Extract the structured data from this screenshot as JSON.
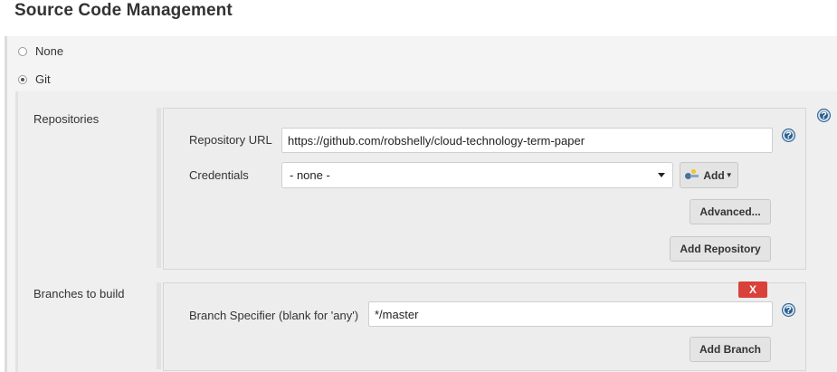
{
  "section": {
    "title": "Source Code Management"
  },
  "scm_options": [
    {
      "label": "None",
      "selected": false
    },
    {
      "label": "Git",
      "selected": true
    }
  ],
  "repositories": {
    "label": "Repositories",
    "url_label": "Repository URL",
    "url_value": "https://github.com/robshelly/cloud-technology-term-paper",
    "credentials_label": "Credentials",
    "credentials_value": "- none -",
    "add_credentials_label": "Add",
    "advanced_label": "Advanced...",
    "add_repository_label": "Add Repository"
  },
  "branches": {
    "label": "Branches to build",
    "delete_label": "X",
    "specifier_label": "Branch Specifier (blank for 'any')",
    "specifier_value": "*/master",
    "add_branch_label": "Add Branch"
  },
  "help_glyph": "?",
  "icons": {
    "help": "help-icon",
    "key": "key-icon",
    "dropdown": "chevron-down-icon"
  },
  "colors": {
    "delete_red": "#d9423a",
    "help_blue": "#2b5f8e"
  }
}
